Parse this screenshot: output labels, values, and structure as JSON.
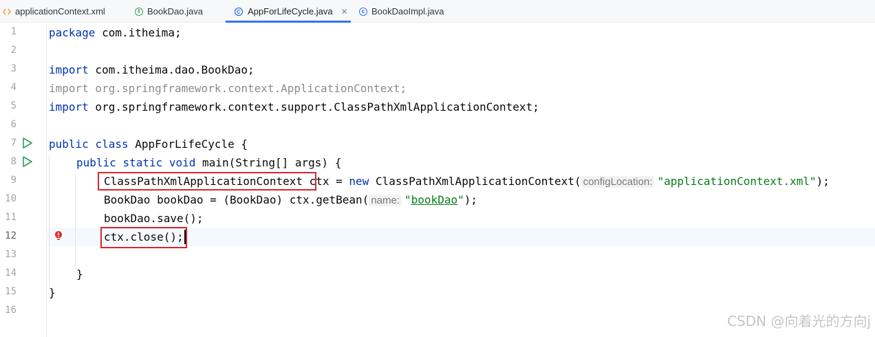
{
  "tabs": [
    {
      "label": "applicationContext.xml",
      "icon": "xml-file-icon"
    },
    {
      "label": "BookDao.java",
      "icon": "interface-icon"
    },
    {
      "label": "AppForLifeCycle.java",
      "icon": "class-icon",
      "active": true
    },
    {
      "label": "BookDaoImpl.java",
      "icon": "class-icon"
    }
  ],
  "editor": {
    "line_numbers": [
      "1",
      "2",
      "3",
      "4",
      "5",
      "6",
      "7",
      "8",
      "9",
      "10",
      "11",
      "12",
      "13",
      "14",
      "15",
      "16"
    ],
    "current_line": "12",
    "lines": {
      "l1": {
        "kw": "package",
        "text": " com.itheima;"
      },
      "l3": {
        "kw": "import",
        "text": " com.itheima.dao.BookDao;"
      },
      "l4": {
        "text": "import org.springframework.context.ApplicationContext;"
      },
      "l5": {
        "kw": "import",
        "text": " org.springframework.context.support.ClassPathXmlApplicationContext;"
      },
      "l7": {
        "kw1": "public",
        "kw2": "class",
        "text": " AppForLifeCycle {"
      },
      "l8": {
        "kw1": "public",
        "kw2": "static",
        "kw3": "void",
        "text": " main(String[] args) {"
      },
      "l9": {
        "type": "ClassPathXmlApplicationContext",
        "pre": " ctx = ",
        "kw": "new",
        "post": " ClassPathXmlApplicationContext(",
        "hint": "configLocation:",
        "str": "\"applicationContext.xml\"",
        "end": ");"
      },
      "l10": {
        "pre": "BookDao bookDao = (BookDao) ctx.getBean(",
        "hint": "name:",
        "q1": "\"",
        "str": "bookDao",
        "q2": "\"",
        "end": ");"
      },
      "l11": {
        "text": "bookDao.save();"
      },
      "l12": {
        "text": "ctx.close();"
      },
      "l14": {
        "text": "}"
      },
      "l15": {
        "text": "}"
      }
    }
  },
  "watermark": "CSDN @向着光的方向j",
  "colors": {
    "keyword": "#0033b3",
    "string": "#067d17",
    "highlight_box": "#d9252b",
    "active_tab": "#3574f0"
  }
}
